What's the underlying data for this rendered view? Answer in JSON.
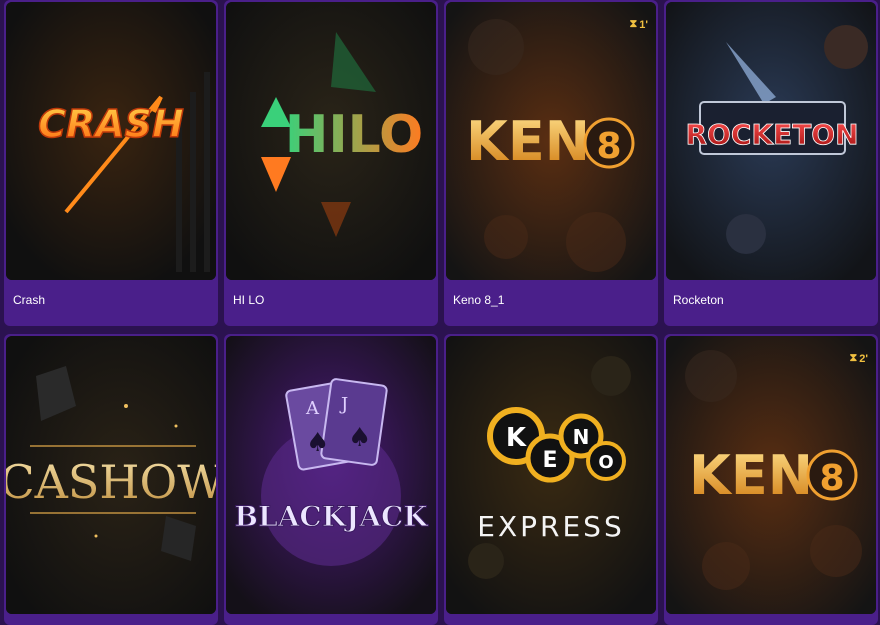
{
  "games": [
    {
      "title": "Crash",
      "logo_text": "CRASH",
      "badge": ""
    },
    {
      "title": "HI LO",
      "logo_text": "HILO",
      "badge": ""
    },
    {
      "title": "Keno 8_1",
      "logo_text": "KEN",
      "logo_number": "8",
      "badge": "1'"
    },
    {
      "title": "Rocketon",
      "logo_text": "ROCKETON",
      "badge": ""
    },
    {
      "title": "",
      "logo_text": "CASHOW",
      "badge": ""
    },
    {
      "title": "",
      "logo_text": "BLACKJACK",
      "badge": ""
    },
    {
      "title": "",
      "logo_letters": [
        "K",
        "E",
        "N",
        "O"
      ],
      "logo_subtext": "EXPRESS",
      "badge": ""
    },
    {
      "title": "",
      "logo_text": "KEN",
      "logo_number": "8",
      "badge": "2'"
    }
  ],
  "icons": {
    "timer": "hourglass-icon"
  },
  "colors": {
    "page_bg": "#2b1250",
    "card_bg": "#4a1f8a",
    "badge": "#f0c040"
  }
}
